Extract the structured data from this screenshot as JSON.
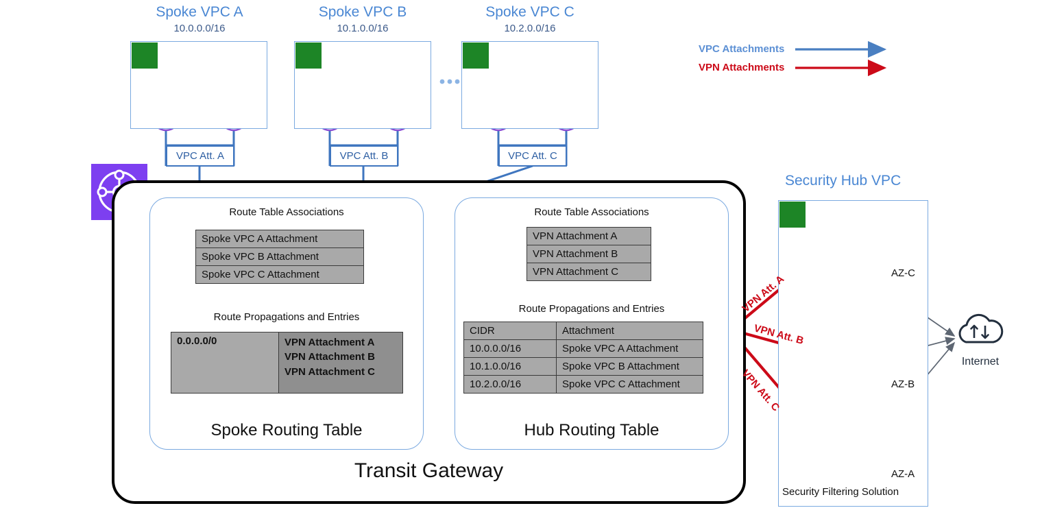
{
  "legend": {
    "items": [
      {
        "label": "VPC Attachments",
        "color": "#4a7fc1",
        "name": "vpc-attachments"
      },
      {
        "label": "VPN Attachments",
        "color": "#cc0a18",
        "name": "vpn-attachments"
      }
    ]
  },
  "spoke_vpcs": [
    {
      "title": "Spoke VPC A",
      "cidr": "10.0.0.0/16",
      "attachment_label": "VPC Att. A"
    },
    {
      "title": "Spoke VPC B",
      "cidr": "10.1.0.0/16",
      "attachment_label": "VPC Att. B"
    },
    {
      "title": "Spoke VPC C",
      "cidr": "10.2.0.0/16",
      "attachment_label": "VPC Att. C"
    }
  ],
  "ellipsis": "....",
  "transit_gateway": {
    "name": "Transit Gateway",
    "spoke_table": {
      "name": "Spoke Routing Table",
      "associations_heading": "Route Table Associations",
      "associations": [
        "Spoke VPC A Attachment",
        "Spoke VPC B Attachment",
        "Spoke VPC C Attachment"
      ],
      "propagations_heading": "Route Propagations and Entries",
      "propagation_cidr": "0.0.0.0/0",
      "propagation_attachments": [
        "VPN Attachment A",
        "VPN Attachment B",
        "VPN Attachment C"
      ]
    },
    "hub_table": {
      "name": "Hub Routing Table",
      "associations_heading": "Route Table Associations",
      "associations": [
        "VPN Attachment A",
        "VPN Attachment B",
        "VPN Attachment C"
      ],
      "propagations_heading": "Route Propagations and Entries",
      "columns": [
        "CIDR",
        "Attachment"
      ],
      "rows": [
        [
          "10.0.0.0/16",
          "Spoke VPC A Attachment"
        ],
        [
          "10.1.0.0/16",
          "Spoke VPC B Attachment"
        ],
        [
          "10.2.0.0/16",
          "Spoke VPC C Attachment"
        ]
      ]
    }
  },
  "security_hub": {
    "title": "Security Hub VPC",
    "footer_label": "Security Filtering Solution",
    "zones": [
      {
        "az": "AZ-C",
        "vpn_label": "VPN Att. A"
      },
      {
        "az": "AZ-B",
        "vpn_label": "VPN Att. B"
      },
      {
        "az": "AZ-A",
        "vpn_label": "VPN Att. C"
      }
    ]
  },
  "internet": {
    "label": "Internet"
  },
  "colors": {
    "vpc_blue": "#4a87d3",
    "line_blue": "#3f76bf",
    "vpn_red": "#cc0a18",
    "aws_green": "#1d8526",
    "tgw_purple": "#7d3ff0",
    "eni_purple": "#8c4fd4",
    "firewall_orange": "#f68b3c",
    "table_grey": "#a9a9a9",
    "table_grey_dark": "#8f8f8f"
  }
}
